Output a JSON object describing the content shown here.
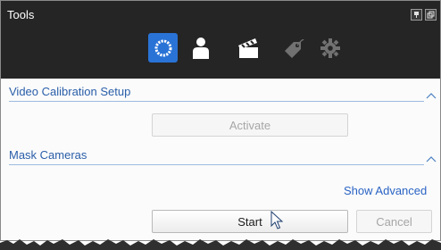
{
  "window": {
    "title": "Tools"
  },
  "toolbar": {
    "items": [
      {
        "icon": "calibration-ring-icon",
        "state": "active"
      },
      {
        "icon": "person-icon",
        "state": "normal"
      },
      {
        "icon": "clapperboard-icon",
        "state": "normal"
      },
      {
        "icon": "tag-icon",
        "state": "disabled"
      },
      {
        "icon": "gear-icon",
        "state": "disabled"
      }
    ]
  },
  "sections": {
    "video_calibration": {
      "title": "Video Calibration Setup",
      "activate_label": "Activate"
    },
    "mask_cameras": {
      "title": "Mask Cameras",
      "show_advanced_label": "Show Advanced"
    }
  },
  "actions": {
    "start_label": "Start",
    "cancel_label": "Cancel"
  },
  "colors": {
    "accent": "#2a73d6",
    "titlebar": "#252525",
    "section_text": "#2a5ea9"
  }
}
